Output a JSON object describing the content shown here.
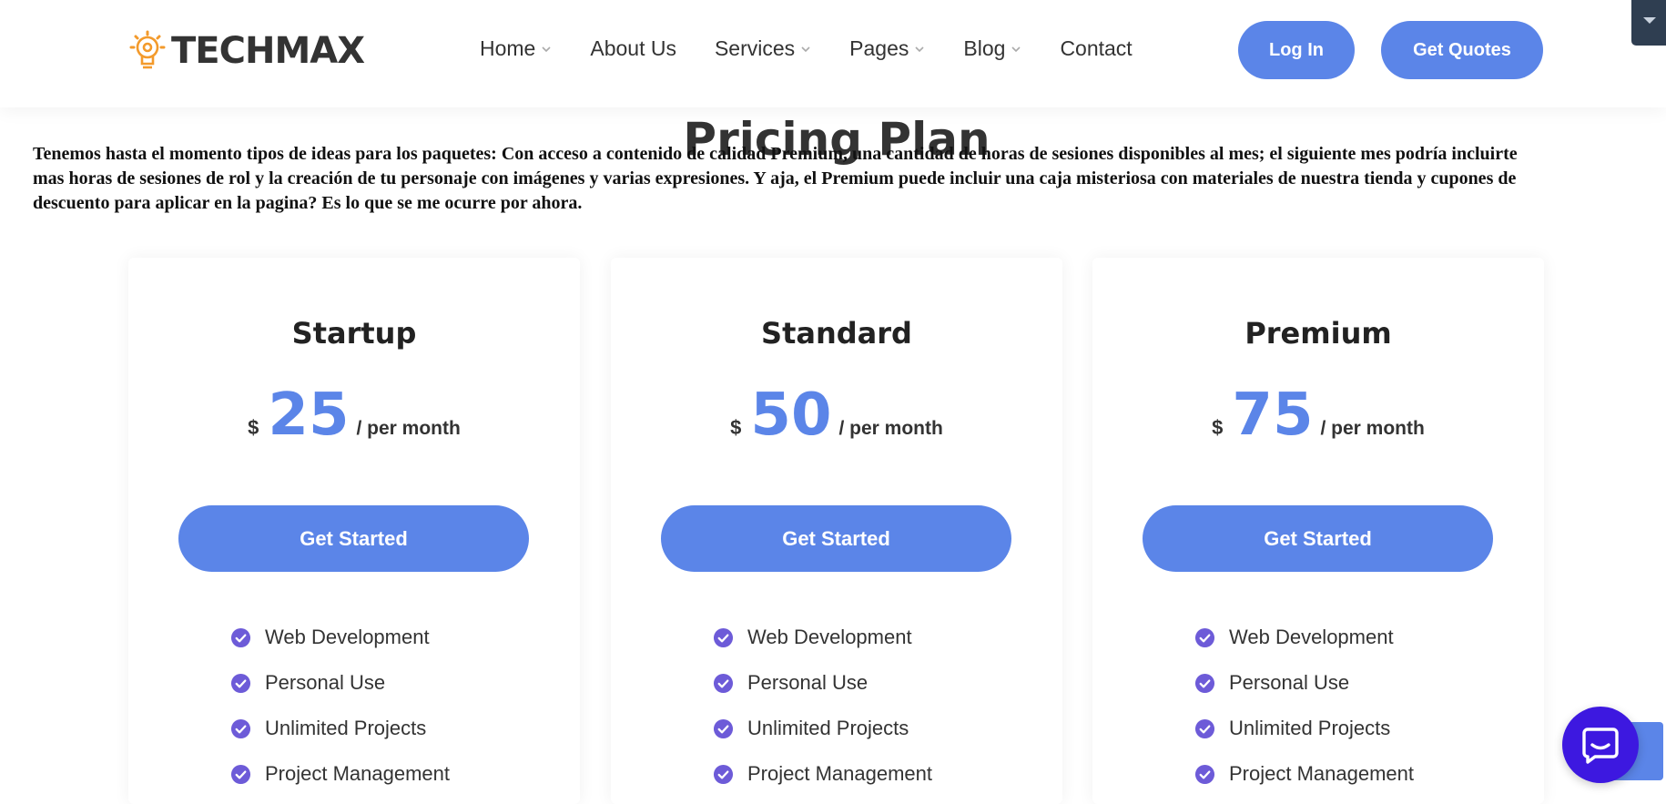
{
  "brand": {
    "name": "TECHMAX"
  },
  "nav": {
    "items": [
      {
        "label": "Home",
        "has_dropdown": true
      },
      {
        "label": "About Us",
        "has_dropdown": false
      },
      {
        "label": "Services",
        "has_dropdown": true
      },
      {
        "label": "Pages",
        "has_dropdown": true
      },
      {
        "label": "Blog",
        "has_dropdown": true
      },
      {
        "label": "Contact",
        "has_dropdown": false
      }
    ],
    "login_label": "Log In",
    "quotes_label": "Get Quotes"
  },
  "section": {
    "title": "Pricing Plan",
    "intro": "Tenemos hasta el momento tipos de ideas para los paquetes: Con acceso a contenido de calidad Premium, una cantidad de horas de sesiones disponibles al mes; el siguiente mes podría incluirte mas horas de sesiones de rol y la creación de tu personaje con imágenes y varias expresiones. Y aja, el Premium puede incluir una caja misteriosa con materiales de nuestra tienda y cupones de descuento para aplicar en la pagina? Es lo que se me ocurre por ahora."
  },
  "plans": [
    {
      "name": "Startup",
      "currency": "$",
      "amount": "25",
      "period": "/ per month",
      "cta": "Get Started",
      "features": [
        "Web Development",
        "Personal Use",
        "Unlimited Projects",
        "Project Management"
      ]
    },
    {
      "name": "Standard",
      "currency": "$",
      "amount": "50",
      "period": "/ per month",
      "cta": "Get Started",
      "features": [
        "Web Development",
        "Personal Use",
        "Unlimited Projects",
        "Project Management"
      ]
    },
    {
      "name": "Premium",
      "currency": "$",
      "amount": "75",
      "period": "/ per month",
      "cta": "Get Started",
      "features": [
        "Web Development",
        "Personal Use",
        "Unlimited Projects",
        "Project Management"
      ]
    }
  ],
  "icons": {
    "logo": "lightbulb-gear-icon",
    "nav_dropdown": "chevron-down-icon",
    "feature": "check-circle-icon",
    "chat": "chat-bubble-icon",
    "corner": "caret-down-icon"
  },
  "colors": {
    "accent": "#5b85e8",
    "check": "#6d5bd8",
    "logo_orange": "#f39a2b",
    "chat": "#3d18e0",
    "corner_tab": "#2f3e51"
  }
}
